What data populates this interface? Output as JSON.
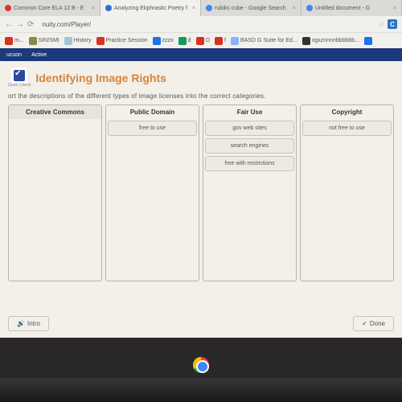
{
  "tabs": [
    {
      "label": "Common Core ELA 12 B - E"
    },
    {
      "label": "Analyzing Ekphrastic Poetry f"
    },
    {
      "label": "rubiks cube - Google Search"
    },
    {
      "label": "Untitled document - G"
    }
  ],
  "url": "nuity.com/Player/",
  "star": "☆",
  "box": "C",
  "bookmarks": [
    "m...",
    "SRI/SMI",
    "History",
    "Practice Session",
    "zzzx",
    "d",
    "O",
    "f",
    "BASD G Suite for Ed...",
    "xgxznnnnbbbbbb...",
    ""
  ],
  "bluebar": {
    "a": "ucuon",
    "b": "Active"
  },
  "qc": "Quick Check",
  "title": "Identifying Image Rights",
  "instr": "ort the descriptions of the different types of image licenses into the correct categories.",
  "cats": [
    {
      "head": "Creative Commons",
      "items": []
    },
    {
      "head": "Public Domain",
      "items": [
        "free to use"
      ]
    },
    {
      "head": "Fair Use",
      "items": [
        "gov web sites",
        "search engines",
        "free with restrictions"
      ]
    },
    {
      "head": "Copyright",
      "items": [
        "not free to use"
      ]
    }
  ],
  "footer": {
    "intro": "Intro",
    "done": "Done"
  }
}
